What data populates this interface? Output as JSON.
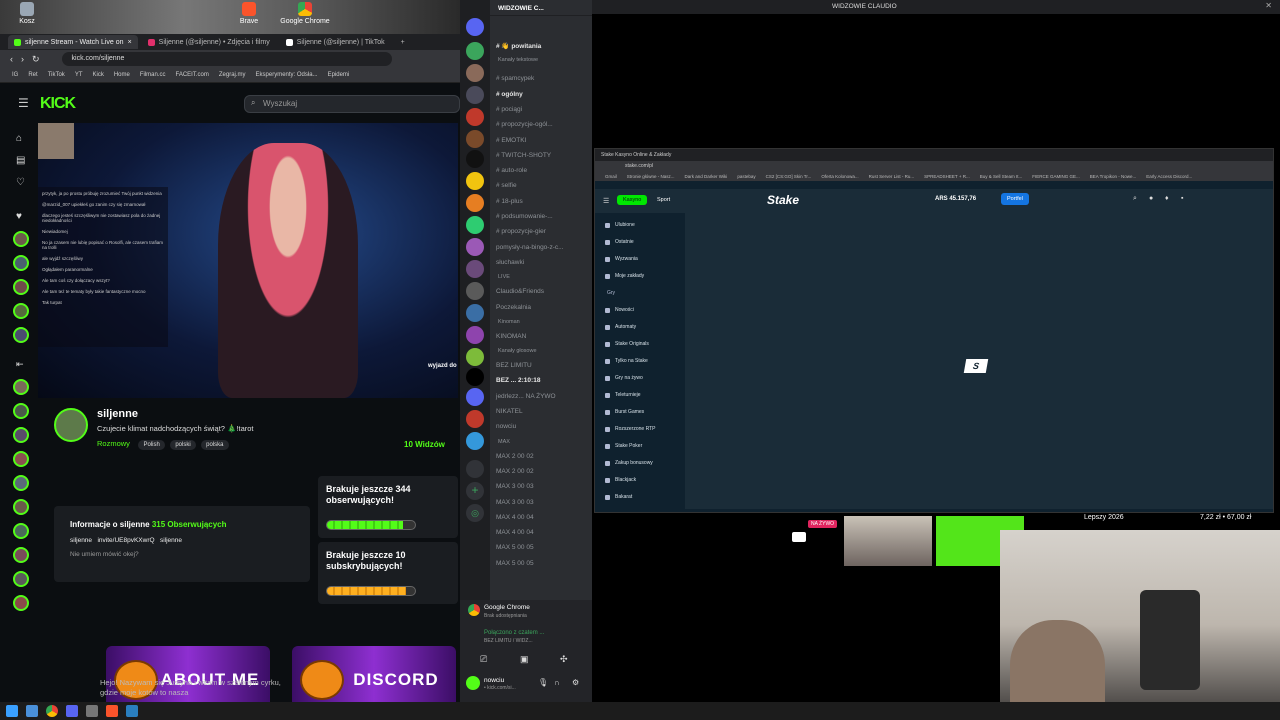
{
  "desktop": {
    "icons": [
      {
        "label": "Kosz"
      },
      {
        "label": "Brave"
      },
      {
        "label": "Google Chrome"
      }
    ]
  },
  "browser": {
    "tabs": [
      "siljenne Stream - Watch Live on",
      "Siljenne (@siljenne) • Zdjęcia i filmy",
      "Siljenne (@siljenne) | TikTok"
    ],
    "url": "kick.com/siljenne",
    "bookmarks": [
      "IG",
      "Ret",
      "TikTok",
      "YT",
      "Kick",
      "Home",
      "Filman.cc",
      "FACEIT.com",
      "Zegraj.my",
      "Eksperymenty: Odsła...",
      "Epidemi"
    ]
  },
  "kick": {
    "logo": "KICK",
    "search_placeholder": "Wyszukaj",
    "chat_lines": [
      "przytyk, ja po prostu próbuję zrozumieć Twój punkt widzenia",
      "@marzid_007 upiekłeś go zanim czy się zmarnował",
      "dlaczego jesteś szczęśliwym nie zostawiasz pola do żadnej niedokładności",
      "Niewiadomej",
      "No ja czasem nie lubię popisać o Rosolfi, ale czasem trafiam na trolli",
      "ale wyjdź szczęśliwy",
      "Ogłądałem paranormalne",
      "Ale tam coś czy dołączacy wszyt?",
      "Ale tam też te tematy były takie fantastyczne mocno",
      "Tak turpat"
    ],
    "streamer_name": "siljenne",
    "stream_title": "Czujecie klimat nadchodzących świąt? 🎄!tarot",
    "category": "Rozmowy",
    "tags": [
      "Polish",
      "polski",
      "polska"
    ],
    "viewers": "10 Widzów",
    "video_overlay": "wyjazd do",
    "about": {
      "title": "Informacje o siljenne",
      "followers": "315 Obserwujących",
      "links": [
        "siljenne",
        "invite/UE8pvKXwrQ",
        "siljenne"
      ],
      "bio": "Nie umiem mówić okej?"
    },
    "goals": [
      {
        "text": "Brakuje jeszcze 344 obserwujących!",
        "progress": 0.86
      },
      {
        "text": "Brakuje jeszcze 10 subskrybujących!",
        "progress": 0.9
      }
    ],
    "panels": [
      "ABOUT ME",
      "DISCORD"
    ],
    "bio_text": "Hejo! Nazywam się Justyna i witam w szalonym cyrku, gdzie moje kotów to nasza"
  },
  "discord": {
    "server_name": "WIDZOWIE C...",
    "channels": [
      {
        "t": "# 👋 powitania",
        "bold": true
      },
      {
        "t": "Kanały tekstowe",
        "cat": true
      },
      {
        "t": "# spamcypek"
      },
      {
        "t": "# ogólny",
        "bold": true
      },
      {
        "t": "# pociągi"
      },
      {
        "t": "# propozycje-ogól..."
      },
      {
        "t": "# EMOTKI"
      },
      {
        "t": "# TWITCH-SHOTY"
      },
      {
        "t": "# auto-role"
      },
      {
        "t": "# selfie"
      },
      {
        "t": "# 18-plus"
      },
      {
        "t": "# podsumowanie-..."
      },
      {
        "t": "# propozycje-gier"
      },
      {
        "t": "pomysły-na-bingo-z-c..."
      },
      {
        "t": "słuchawki"
      },
      {
        "t": "LIVE",
        "cat": true
      },
      {
        "t": "Claudio&Friends"
      },
      {
        "t": "Poczekalnia"
      },
      {
        "t": "Kinoman",
        "cat": true
      },
      {
        "t": "KINOMAN"
      },
      {
        "t": "Kanały głosowe",
        "cat": true
      },
      {
        "t": "BEZ LIMITU"
      },
      {
        "t": "BEZ ...  2:10:18",
        "bold": true
      },
      {
        "t": "jedrlezz... NA ŻYWO"
      },
      {
        "t": "NIKATEL"
      },
      {
        "t": "nowciu"
      },
      {
        "t": "MAX",
        "cat": true
      },
      {
        "t": "MAX 2   00 02"
      },
      {
        "t": "MAX 2   00 02"
      },
      {
        "t": "MAX 3   00 03"
      },
      {
        "t": "MAX 3   00 03"
      },
      {
        "t": "MAX 4   00 04"
      },
      {
        "t": "MAX 4   00 04"
      },
      {
        "t": "MAX 5   00 05"
      },
      {
        "t": "MAX 5   00 05"
      }
    ],
    "activity": {
      "app": "Google Chrome",
      "sub": "Brak udostępniania",
      "voice": "Połączono z czatem ...",
      "voice_sub": "BEZ LIMITU / WIDZ..."
    },
    "user": {
      "name": "nowciu",
      "sub": "• kick.com/si..."
    }
  },
  "window_title": "WIDZOWIE CLAUDIO",
  "stake": {
    "tab": "Stake Kasyno Online & Zakłady",
    "url": "stake.com/pl",
    "bookmarks": [
      "Gmail",
      "Stronie główne - Nasz...",
      "Dark and Darker Wiki",
      "pastebay",
      "CS2 [CS:GO] Skin Tr...",
      "Oferta Kolonowa...",
      "Rust Server List - Ru...",
      "SPREADSHEET + R...",
      "Buy & Sell Steam It...",
      "FIERCE GAMING GE...",
      "BEA Tropikon - Nowe...",
      "Early Access Discord..."
    ],
    "nav": [
      "Kasyno",
      "Sport"
    ],
    "logo": "Stake",
    "balance": "ARS 45.157,76",
    "wallet": "Portfel",
    "side": [
      "Ulubione",
      "Ostatnie",
      "Wyzwania",
      "Moje zakłady"
    ],
    "side_label": "Gry",
    "side2": [
      "Nowości",
      "Automaty",
      "Stake Originals",
      "Tylko na Stake",
      "Gry na żywo",
      "Teleturnieje",
      "Burst Games",
      "Rozszerzone RTP",
      "Stake Poker",
      "Zakup bonusowy",
      "Blackjack",
      "Bakarat"
    ]
  },
  "cam_strip": {
    "live": "NA ŻYWO",
    "goal": "Lepszy 2026",
    "amount": "7,22 zł • 67,00 zł"
  }
}
